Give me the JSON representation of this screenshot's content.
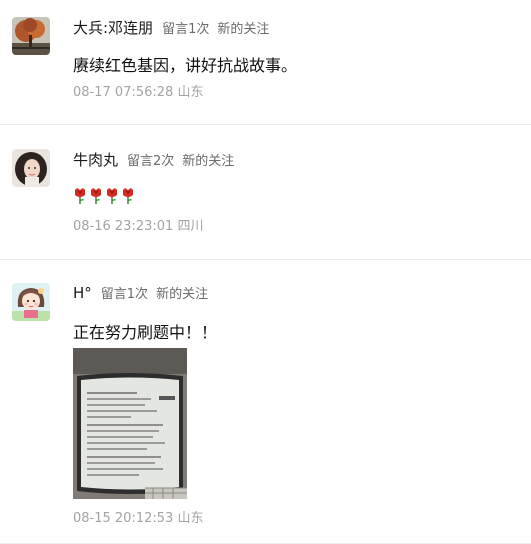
{
  "comments": [
    {
      "nickname": "大兵:邓连朋",
      "message_count": "留言1次",
      "new_follow": "新的关注",
      "text": "赓续红色基因，讲好抗战故事。",
      "time": "08-17 07:56:28",
      "location": "山东",
      "avatar_icon": "autumn-tree-avatar"
    },
    {
      "nickname": "牛肉丸",
      "message_count": "留言2次",
      "new_follow": "新的关注",
      "emoji": [
        "rose",
        "rose",
        "rose",
        "rose"
      ],
      "time": "08-16 23:23:01",
      "location": "四川",
      "avatar_icon": "girl-photo-avatar"
    },
    {
      "nickname": "H°",
      "message_count": "留言1次",
      "new_follow": "新的关注",
      "text": "正在努力刷题中！！",
      "image_icon": "tablet-exam-photo",
      "time": "08-15 20:12:53",
      "location": "山东",
      "avatar_icon": "cartoon-girl-avatar"
    }
  ],
  "colors": {
    "rose": "#d42a1f",
    "muted_text": "#a3a3a3",
    "tag_text": "#6b6b6b",
    "divider": "#ececec"
  }
}
